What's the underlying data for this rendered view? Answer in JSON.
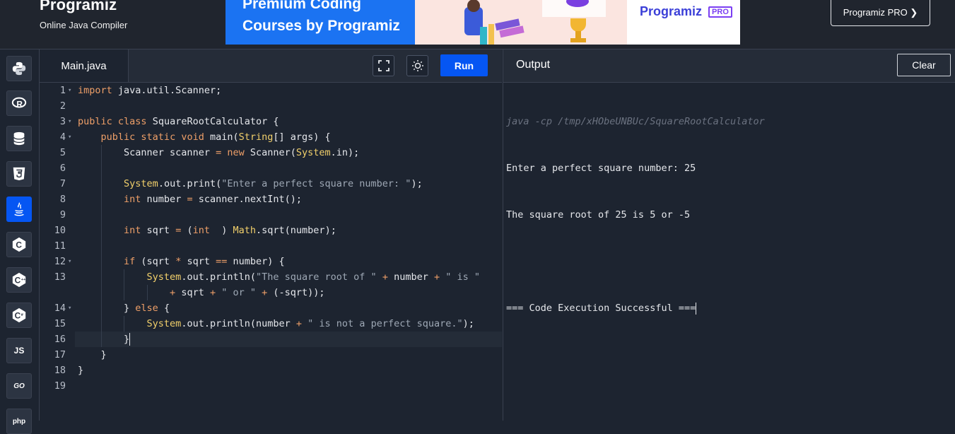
{
  "header": {
    "brand": "Programiz",
    "subtitle": "Online Java Compiler",
    "banner": {
      "line1": "Premium Coding",
      "line2": "Courses by Programiz",
      "logo": "Programiz",
      "badge": "PRO"
    },
    "pro_button": "Programiz PRO ❯"
  },
  "languages": [
    {
      "name": "python",
      "icon": "python-icon",
      "label": ""
    },
    {
      "name": "r",
      "icon": "r-icon",
      "label": "R"
    },
    {
      "name": "sql",
      "icon": "database-icon",
      "label": ""
    },
    {
      "name": "html",
      "icon": "html5-icon",
      "label": "5"
    },
    {
      "name": "java",
      "icon": "java-icon",
      "label": "",
      "active": true
    },
    {
      "name": "c",
      "icon": "c-icon",
      "label": "C"
    },
    {
      "name": "cpp",
      "icon": "cpp-icon",
      "label": "C"
    },
    {
      "name": "csharp",
      "icon": "csharp-icon",
      "label": "C"
    },
    {
      "name": "js",
      "icon": "js-icon",
      "label": "JS"
    },
    {
      "name": "go",
      "icon": "go-icon",
      "label": "GO"
    },
    {
      "name": "php",
      "icon": "php-icon",
      "label": "php"
    }
  ],
  "editor": {
    "tab": "Main.java",
    "run_label": "Run",
    "lines": [
      {
        "n": "1",
        "fold": true,
        "indent": 0,
        "tokens": [
          [
            "kw",
            "import"
          ],
          [
            "",
            "java.util.Scanner;"
          ]
        ]
      },
      {
        "n": "2",
        "indent": 0,
        "tokens": []
      },
      {
        "n": "3",
        "fold": true,
        "indent": 0,
        "tokens": [
          [
            "kw",
            "public"
          ],
          [
            "kw",
            "class"
          ],
          [
            "",
            "SquareRootCalculator {"
          ]
        ]
      },
      {
        "n": "4",
        "fold": true,
        "indent": 1,
        "tokens": [
          [
            "kw",
            "public"
          ],
          [
            "kw",
            "static"
          ],
          [
            "kw",
            "void"
          ],
          [
            "",
            "main("
          ],
          [
            "cls",
            "String"
          ],
          [
            "",
            "[] args) {"
          ]
        ]
      },
      {
        "n": "5",
        "indent": 2,
        "tokens": [
          [
            "",
            "Scanner scanner "
          ],
          [
            "op",
            "="
          ],
          [
            "kw",
            "new"
          ],
          [
            "",
            "Scanner("
          ],
          [
            "cls",
            "System"
          ],
          [
            "",
            ".in);"
          ]
        ]
      },
      {
        "n": "6",
        "indent": 2,
        "tokens": []
      },
      {
        "n": "7",
        "indent": 2,
        "tokens": [
          [
            "cls",
            "System"
          ],
          [
            "",
            ".out.print("
          ],
          [
            "str",
            "\"Enter a perfect square number: \""
          ],
          [
            "",
            ");"
          ]
        ]
      },
      {
        "n": "8",
        "indent": 2,
        "tokens": [
          [
            "kw",
            "int"
          ],
          [
            "",
            "number "
          ],
          [
            "op",
            "="
          ],
          [
            "",
            "scanner.nextInt();"
          ]
        ]
      },
      {
        "n": "9",
        "indent": 2,
        "tokens": []
      },
      {
        "n": "10",
        "indent": 2,
        "tokens": [
          [
            "kw",
            "int"
          ],
          [
            "",
            "sqrt "
          ],
          [
            "op",
            "="
          ],
          [
            "",
            "("
          ],
          [
            "kw",
            "int"
          ],
          [
            "",
            " ) "
          ],
          [
            "cls",
            "Math"
          ],
          [
            "",
            ".sqrt(number);"
          ]
        ]
      },
      {
        "n": "11",
        "indent": 2,
        "tokens": []
      },
      {
        "n": "12",
        "fold": true,
        "indent": 2,
        "tokens": [
          [
            "kw",
            "if"
          ],
          [
            "",
            "(sqrt "
          ],
          [
            "op",
            "*"
          ],
          [
            "",
            "sqrt "
          ],
          [
            "op",
            "=="
          ],
          [
            "",
            "number) {"
          ]
        ]
      },
      {
        "n": "13",
        "indent": 3,
        "tokens": [
          [
            "cls",
            "System"
          ],
          [
            "",
            ".out.println("
          ],
          [
            "str",
            "\"The square root of \""
          ],
          [
            "op",
            "+"
          ],
          [
            "",
            "number "
          ],
          [
            "op",
            "+"
          ],
          [
            "str",
            "\" is \""
          ]
        ]
      },
      {
        "n": "",
        "indent": 4,
        "tokens": [
          [
            "op",
            "+"
          ],
          [
            "",
            "sqrt "
          ],
          [
            "op",
            "+"
          ],
          [
            "str",
            "\" or \""
          ],
          [
            "op",
            "+"
          ],
          [
            "",
            "(-sqrt));"
          ]
        ]
      },
      {
        "n": "14",
        "fold": true,
        "indent": 2,
        "tokens": [
          [
            "",
            "} "
          ],
          [
            "kw",
            "else"
          ],
          [
            "",
            "{"
          ]
        ]
      },
      {
        "n": "15",
        "indent": 3,
        "tokens": [
          [
            "cls",
            "System"
          ],
          [
            "",
            ".out.println(number "
          ],
          [
            "op",
            "+"
          ],
          [
            "str",
            "\" is not a perfect square.\""
          ],
          [
            "",
            ");"
          ]
        ]
      },
      {
        "n": "16",
        "indent": 2,
        "cursor": true,
        "tokens": [
          [
            "",
            "}"
          ]
        ]
      },
      {
        "n": "17",
        "indent": 1,
        "tokens": [
          [
            "",
            "}"
          ]
        ]
      },
      {
        "n": "18",
        "indent": 0,
        "tokens": [
          [
            "",
            "}"
          ]
        ]
      },
      {
        "n": "19",
        "indent": 0,
        "tokens": []
      }
    ]
  },
  "output": {
    "title": "Output",
    "clear_label": "Clear",
    "command": "java -cp /tmp/xHObeUNBUc/SquareRootCalculator",
    "lines": [
      "Enter a perfect square number: 25",
      "The square root of 25 is 5 or -5",
      "",
      "=== Code Execution Successful ==="
    ]
  }
}
